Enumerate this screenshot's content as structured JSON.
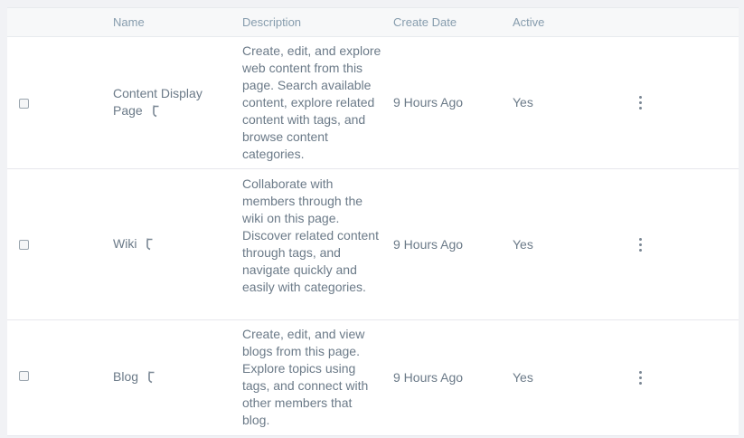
{
  "table": {
    "headers": {
      "name": "Name",
      "description": "Description",
      "create_date": "Create Date",
      "active": "Active"
    },
    "rows": [
      {
        "name_line1": "Content Display",
        "name_line2": "Page",
        "description": "Create, edit, and explore web content from this page. Search available content, explore related content with tags, and browse content categories.",
        "create_date": "9 Hours Ago",
        "active": "Yes",
        "icon": "link-arrow-icon"
      },
      {
        "name_line1": "Wiki",
        "description": "Collaborate with members through the wiki on this page. Discover related content through tags, and navigate quickly and easily with categories.",
        "create_date": "9 Hours Ago",
        "active": "Yes",
        "icon": "link-arrow-icon"
      },
      {
        "name_line1": "Blog",
        "description": "Create, edit, and view blogs from this page. Explore topics using tags, and connect with other members that blog.",
        "create_date": "9 Hours Ago",
        "active": "Yes",
        "icon": "link-arrow-icon"
      }
    ]
  },
  "colors": {
    "header_bg": "#f7f8f9",
    "text": "#6b7a88",
    "header_text": "#869cad",
    "border": "#e7e7ed"
  }
}
